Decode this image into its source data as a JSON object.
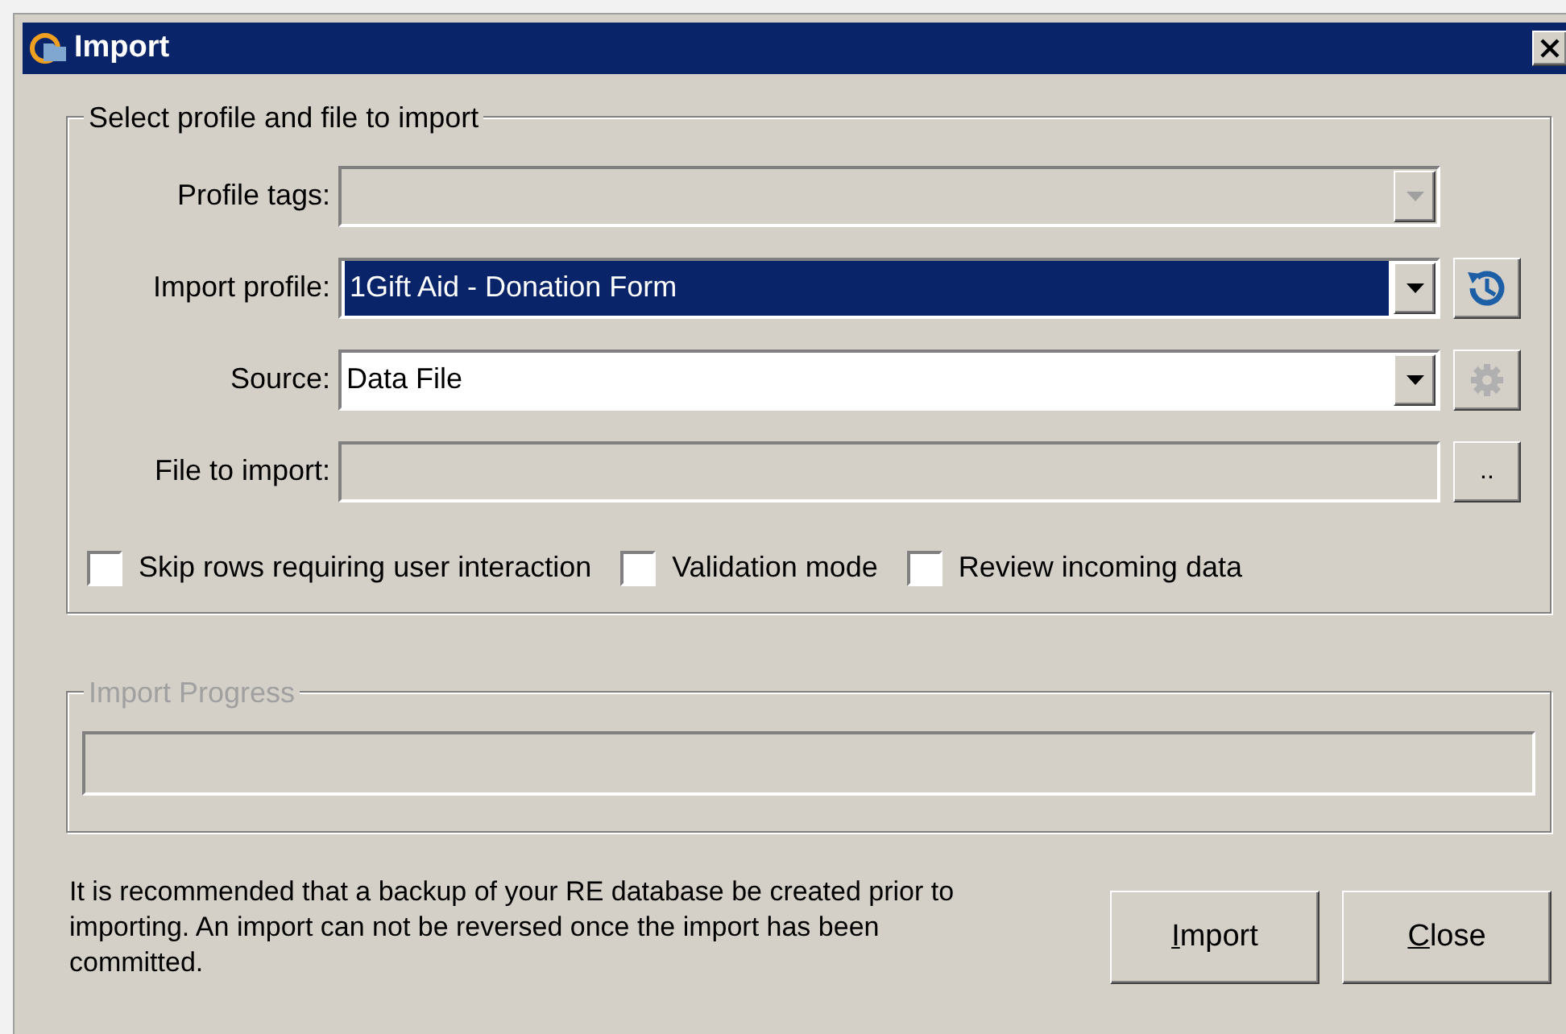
{
  "window": {
    "title": "Import"
  },
  "profile_group": {
    "title": "Select profile and file to import",
    "rows": [
      {
        "kind": "combo",
        "label": "Profile tags:",
        "value": "",
        "disabled": true,
        "highlighted": false,
        "side_button": null
      },
      {
        "kind": "combo",
        "label": "Import profile:",
        "value": "1Gift Aid - Donation Form",
        "disabled": false,
        "highlighted": true,
        "side_button": {
          "kind": "history",
          "disabled": false
        }
      },
      {
        "kind": "combo",
        "label": "Source:",
        "value": "Data File",
        "disabled": false,
        "highlighted": false,
        "side_button": {
          "kind": "settings",
          "disabled": true
        }
      },
      {
        "kind": "file",
        "label": "File to import:",
        "value": "",
        "disabled": true,
        "highlighted": false,
        "side_button": {
          "kind": "browse",
          "text": "..",
          "disabled": false
        }
      }
    ],
    "checkboxes": [
      {
        "label": "Skip rows requiring user interaction",
        "checked": false
      },
      {
        "label": "Validation mode",
        "checked": false
      },
      {
        "label": "Review incoming data",
        "checked": false
      }
    ]
  },
  "progress_group": {
    "title": "Import Progress",
    "disabled": true,
    "level": 0
  },
  "notice": "It is recommended that a backup of your RE database be created prior to importing. An import can not be reversed once the import has been committed.",
  "buttons": [
    {
      "mnemonic": "I",
      "rest": "mport"
    },
    {
      "mnemonic": "C",
      "rest": "lose"
    }
  ]
}
